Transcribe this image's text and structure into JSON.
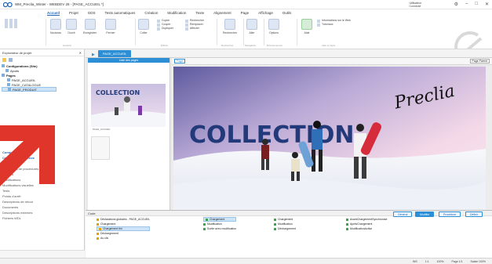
{
  "window": {
    "title": "WM_Preclia_Winter - WEBDEV 28 - [PAGE_ACCUEIL *]",
    "user_line1": "Utilisateur",
    "user_line2": "Connecté"
  },
  "menu": {
    "items": [
      "Accueil",
      "Projet",
      "GDS",
      "Tests automatiques",
      "Création",
      "Modification",
      "Texte",
      "Alignement",
      "Page",
      "Affichage",
      "Outils"
    ]
  },
  "ribbon": {
    "buttons": [
      {
        "label": "Nouveau"
      },
      {
        "label": "Ouvrir"
      },
      {
        "label": "Enregistrer"
      },
      {
        "label": "Fermer"
      },
      {
        "label": "Coller"
      },
      {
        "label": "Rechercher"
      },
      {
        "label": "Aller"
      },
      {
        "label": "Options"
      },
      {
        "label": "Aide"
      }
    ],
    "small": [
      "Copier",
      "Couper",
      "Dupliquer",
      "Rechercher",
      "Remplacer",
      "Affecter"
    ],
    "info_label": "Informations sur le Web",
    "tutorials_label": "Tutoriaux",
    "groups": [
      "Général",
      "Édition",
      "Rechercher",
      "Navigation",
      "Environnement",
      "Aide en ligne"
    ]
  },
  "explorer": {
    "title": "Explorateur de projet",
    "tree": [
      {
        "label": "Configurations (Site)",
        "bold": true
      },
      {
        "label": "Ajouts",
        "bold": false
      },
      {
        "label": "Pages",
        "bold": true
      },
      {
        "label": "PAGE_ACCUEIL",
        "bold": false
      },
      {
        "label": "PAGE_CATALOGUE",
        "bold": false
      },
      {
        "label": "PAGE_PRODUIT",
        "bold": false,
        "selected": true
      }
    ],
    "sections": [
      "Composants",
      "Composants internes",
      "Procédures",
      "Collections de procédures",
      "Classes",
      "Modifications",
      "Modifications visuelles",
      "Tests",
      "Points d'arrêt",
      "Descriptions de retour",
      "Documents",
      "Descriptions externes",
      "Fichiers WDL"
    ]
  },
  "doc": {
    "tab_label": "PAGE_ACCUEIL",
    "thumb_header": "Liste des pages",
    "thumb_collection": "COLLECTION",
    "thumb_caption": "PAGE_ACCUEIL",
    "page_tag": "Page",
    "page_button": "Page Parent",
    "hero_title": "COLLECTION",
    "signature": "Preclia"
  },
  "code": {
    "title": "Code",
    "left_items": [
      "Déclarations globales - PAGE_ACCUEIL",
      "Chargement",
      "Chargement fini",
      "Déchargement",
      "Au clic"
    ],
    "mid_items": [
      "Chargement",
      "Modification",
      "Sortie avec modification",
      "Entrée",
      "Survol"
    ],
    "right_items": [
      "Chargement",
      "Modification",
      "Déchargement"
    ],
    "far_items": [
      "AvantChargementSynchronisé",
      "AprèsChargement",
      "ModificationActive"
    ],
    "pills": [
      "Général",
      "Modifier",
      "Procédure",
      "Définir"
    ]
  },
  "statusbar": {
    "items": [
      "INS",
      "1:1",
      "100%",
      "Page 1/1",
      "Saisie 100%"
    ]
  },
  "colors": {
    "accent": "#2c8fd6",
    "brand_dark": "#233a7a",
    "arrow": "#e0352b"
  }
}
